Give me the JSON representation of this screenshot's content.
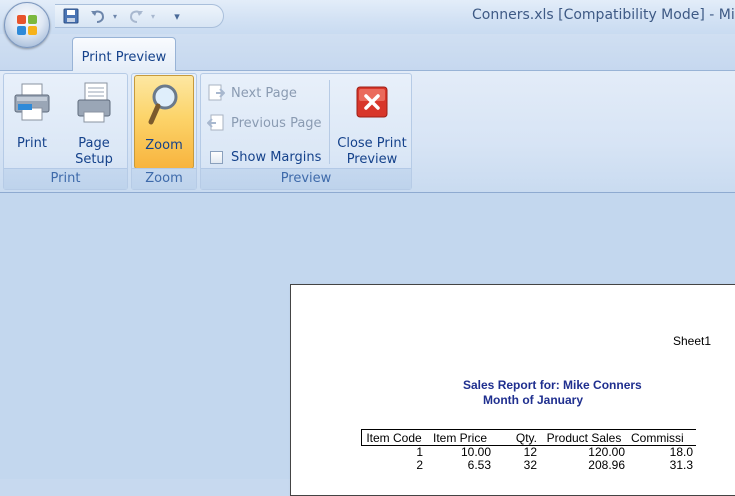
{
  "window": {
    "title": "Conners.xls  [Compatibility Mode] - Mic"
  },
  "quick_access": {
    "save_icon": "save-icon",
    "undo_icon": "undo-icon",
    "redo_icon": "redo-icon",
    "customize_icon": "customize-qat-icon"
  },
  "ribbon": {
    "active_tab": "Print Preview",
    "groups": {
      "print": {
        "label": "Print",
        "print_button": "Print",
        "page_setup_line1": "Page",
        "page_setup_line2": "Setup"
      },
      "zoom": {
        "label": "Zoom",
        "zoom_button": "Zoom"
      },
      "preview": {
        "label": "Preview",
        "next_page": "Next Page",
        "previous_page": "Previous Page",
        "show_margins": "Show Margins",
        "close_line1": "Close Print",
        "close_line2": "Preview"
      }
    }
  },
  "page": {
    "header": "Sheet1",
    "report_title_line1": "Sales Report for: Mike Conners",
    "report_title_line2": "Month of January",
    "table": {
      "columns": [
        "Item Code",
        "Item Price",
        "Qty.",
        "Product Sales",
        "Commissi"
      ],
      "rows": [
        [
          "1",
          "10.00",
          "12",
          "120.00",
          "18.0"
        ],
        [
          "2",
          "6.53",
          "32",
          "208.96",
          "31.3"
        ]
      ]
    }
  },
  "colors": {
    "ribbon_blue": "#c9dbf0",
    "tab_text": "#15428b",
    "zoom_active": "#fcd46a",
    "report_title": "#1f2f8f"
  }
}
